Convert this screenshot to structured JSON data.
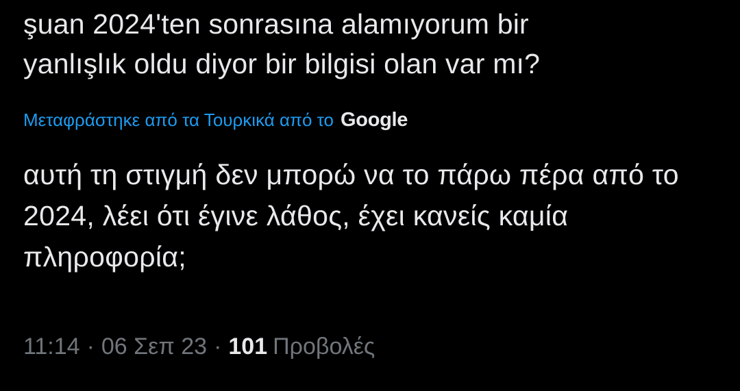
{
  "tweet": {
    "original_text": "şuan 2024'ten sonrasına alamıyorum bir\nyanlışlık oldu diyor bir bilgisi olan var mı?",
    "translation": {
      "link_text": "Μεταφράστηκε από τα Τουρκικά από το",
      "provider": "Google"
    },
    "translated_text": "αυτή τη στιγμή δεν μπορώ να το πάρω πέρα από το 2024, λέει ότι έγινε λάθος, έχει κανείς καμία πληροφορία;",
    "meta": {
      "time": "11:14",
      "separator": "·",
      "date": "06 Σεπ 23",
      "views_count": "101",
      "views_label": "Προβολές"
    }
  },
  "colors": {
    "background": "#000000",
    "text": "#e7e9ea",
    "link": "#1d9bf0",
    "muted": "#71767b"
  }
}
